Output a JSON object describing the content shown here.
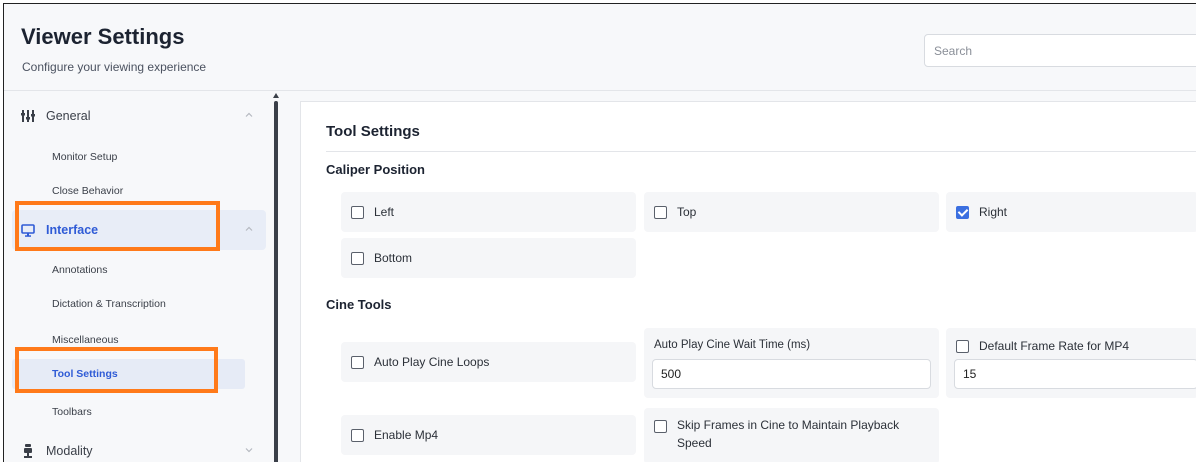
{
  "header": {
    "title": "Viewer Settings",
    "subtitle": "Configure your viewing experience",
    "search_placeholder": "Search"
  },
  "sidebar": {
    "groups": [
      {
        "label": "General",
        "icon": "sliders-icon",
        "expanded": true
      },
      {
        "label": "Interface",
        "icon": "monitor-icon",
        "expanded": true,
        "active": true
      },
      {
        "label": "Modality",
        "icon": "scanner-icon",
        "expanded": false
      }
    ],
    "general_items": [
      "Monitor Setup",
      "Close Behavior"
    ],
    "interface_items": [
      "Annotations",
      "Dictation & Transcription",
      "Miscellaneous",
      "Tool Settings",
      "Toolbars"
    ],
    "active_item": "Tool Settings"
  },
  "main": {
    "title": "Tool Settings",
    "caliper": {
      "title": "Caliper Position",
      "options": [
        {
          "label": "Left",
          "checked": false
        },
        {
          "label": "Top",
          "checked": false
        },
        {
          "label": "Right",
          "checked": true
        },
        {
          "label": "Bottom",
          "checked": false
        }
      ]
    },
    "cine": {
      "title": "Cine Tools",
      "auto_play_label": "Auto Play Cine Loops",
      "auto_play_checked": false,
      "wait_time_label": "Auto Play Cine Wait Time (ms)",
      "wait_time_value": "500",
      "frame_rate_label": "Default Frame Rate for MP4",
      "frame_rate_checked": false,
      "frame_rate_value": "15",
      "enable_mp4_label": "Enable Mp4",
      "enable_mp4_checked": false,
      "skip_frames_label": "Skip Frames in Cine to Maintain Playback Speed",
      "skip_frames_checked": false
    }
  },
  "colors": {
    "accent": "#2f5bd6",
    "highlight": "#ff7a1a",
    "checkbox_checked": "#3b6fe0"
  }
}
